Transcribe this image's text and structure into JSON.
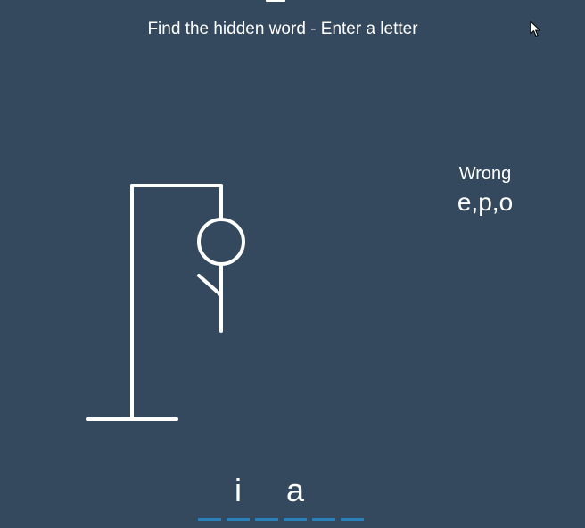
{
  "instructions": "Find the hidden word - Enter a letter",
  "wrong": {
    "title": "Wrong",
    "letters": "e,p,o"
  },
  "word": [
    "",
    "i",
    "",
    "a",
    "",
    ""
  ],
  "colors": {
    "background": "#34495e",
    "foreground": "#ffffff",
    "slot_underline": "#2980b9"
  },
  "icons": [
    "mouse-cursor-icon"
  ]
}
